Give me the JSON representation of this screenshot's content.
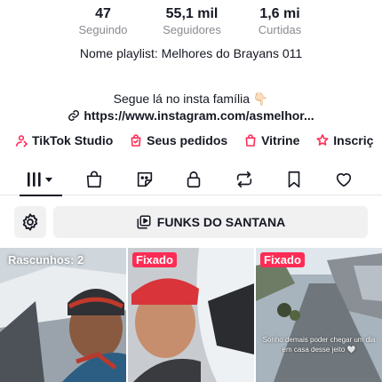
{
  "stats": [
    {
      "value": "47",
      "label": "Seguindo"
    },
    {
      "value": "55,1 mil",
      "label": "Seguidores"
    },
    {
      "value": "1,6 mi",
      "label": "Curtidas"
    }
  ],
  "bio": {
    "playlist_name": "Nome playlist: Melhores do Brayans 011",
    "line": "Segue lá no insta família 👇🏻",
    "link": "https://www.instagram.com/asmelhor..."
  },
  "shortcuts": [
    {
      "label": "TikTok Studio",
      "icon": "studio-icon"
    },
    {
      "label": "Seus pedidos",
      "icon": "orders-icon"
    },
    {
      "label": "Vitrine",
      "icon": "showcase-bag-icon"
    },
    {
      "label": "Inscriç",
      "icon": "subscription-icon"
    }
  ],
  "tabs": [
    {
      "name": "videos-grid",
      "icon": "grid-bars-icon",
      "active": true
    },
    {
      "name": "shop",
      "icon": "shopping-bag-icon",
      "active": false
    },
    {
      "name": "stickers",
      "icon": "sticker-icon",
      "active": false
    },
    {
      "name": "private",
      "icon": "lock-icon",
      "active": false
    },
    {
      "name": "reposts",
      "icon": "repost-icon",
      "active": false
    },
    {
      "name": "favorites",
      "icon": "bookmark-icon",
      "active": false
    },
    {
      "name": "liked",
      "icon": "heart-icon",
      "active": false
    }
  ],
  "playlist": {
    "title": "FUNKS DO SANTANA"
  },
  "videos": [
    {
      "badge": "Rascunhos: 2",
      "badge_style": "plain",
      "caption": ""
    },
    {
      "badge": "Fixado",
      "badge_style": "pinned",
      "caption": ""
    },
    {
      "badge": "Fixado",
      "badge_style": "pinned",
      "caption": "Sonho demais poder chegar um dia em casa desse jeito 🤍"
    }
  ],
  "colors": {
    "accent": "#fe2c55",
    "text": "#161823",
    "muted": "#8a8b91",
    "button_bg": "#f1f1f2"
  }
}
